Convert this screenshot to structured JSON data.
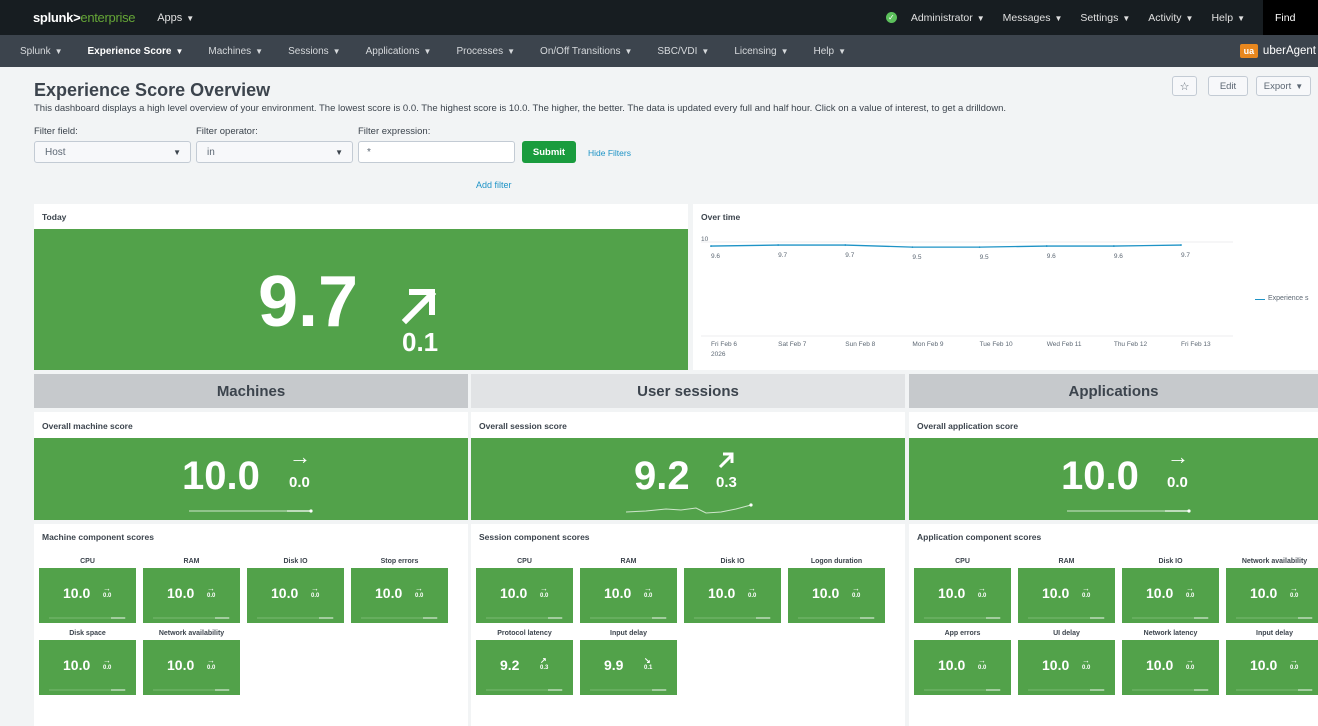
{
  "topbar": {
    "brand_main": "splunk>",
    "brand_sub": "enterprise",
    "apps": "Apps",
    "right_items": [
      "Administrator",
      "Messages",
      "Settings",
      "Activity",
      "Help"
    ],
    "find": "Find"
  },
  "nav": {
    "items": [
      "Splunk",
      "Experience Score",
      "Machines",
      "Sessions",
      "Applications",
      "Processes",
      "On/Off Transitions",
      "SBC/VDI",
      "Licensing",
      "Help"
    ],
    "active_index": 1,
    "brand": "uberAgent",
    "brand_icon": "ua"
  },
  "header": {
    "title": "Experience Score Overview",
    "description": "This dashboard displays a high level overview of your environment. The lowest score is 0.0. The highest score is 10.0. The higher, the better. The data is updated every full and half hour. Click on a value of interest, to get a drilldown.",
    "star": "☆",
    "edit": "Edit",
    "export": "Export"
  },
  "filters": {
    "field_label": "Filter field:",
    "field_value": "Host",
    "operator_label": "Filter operator:",
    "operator_value": "in",
    "expression_label": "Filter expression:",
    "expression_value": "*",
    "submit": "Submit",
    "hide": "Hide Filters",
    "add": "Add filter"
  },
  "today": {
    "title": "Today",
    "value": "9.7",
    "trend": "up",
    "delta": "0.1"
  },
  "over_time": {
    "title": "Over time",
    "legend": "Experience s",
    "y_tick": "10",
    "date_year": "2026"
  },
  "chart_data": {
    "type": "line",
    "x": [
      "Fri Feb 6",
      "Sat Feb 7",
      "Sun Feb 8",
      "Mon Feb 9",
      "Tue Feb 10",
      "Wed Feb 11",
      "Thu Feb 12",
      "Fri Feb 13"
    ],
    "series": [
      {
        "name": "Experience s",
        "values": [
          9.6,
          9.7,
          9.7,
          9.5,
          9.5,
          9.6,
          9.6,
          9.7
        ]
      }
    ],
    "y_ticks": [
      "10"
    ],
    "ylim": [
      0,
      10
    ],
    "legend_position": "right",
    "color": "#1e93c6"
  },
  "sections": [
    "Machines",
    "User sessions",
    "Applications"
  ],
  "overall": [
    {
      "title": "Overall machine score",
      "value": "10.0",
      "trend": "right",
      "delta": "0.0"
    },
    {
      "title": "Overall session score",
      "value": "9.2",
      "trend": "up",
      "delta": "0.3"
    },
    {
      "title": "Overall application score",
      "value": "10.0",
      "trend": "right",
      "delta": "0.0"
    }
  ],
  "components": [
    {
      "title": "Machine component scores",
      "tiles": [
        {
          "label": "CPU",
          "value": "10.0",
          "trend": "right",
          "delta": "0.0"
        },
        {
          "label": "RAM",
          "value": "10.0",
          "trend": "right",
          "delta": "0.0"
        },
        {
          "label": "Disk IO",
          "value": "10.0",
          "trend": "right",
          "delta": "0.0"
        },
        {
          "label": "Stop errors",
          "value": "10.0",
          "trend": "right",
          "delta": "0.0"
        },
        {
          "label": "Disk space",
          "value": "10.0",
          "trend": "right",
          "delta": "0.0"
        },
        {
          "label": "Network availability",
          "value": "10.0",
          "trend": "right",
          "delta": "0.0"
        }
      ]
    },
    {
      "title": "Session component scores",
      "tiles": [
        {
          "label": "CPU",
          "value": "10.0",
          "trend": "right",
          "delta": "0.0"
        },
        {
          "label": "RAM",
          "value": "10.0",
          "trend": "right",
          "delta": "0.0"
        },
        {
          "label": "Disk IO",
          "value": "10.0",
          "trend": "right",
          "delta": "0.0"
        },
        {
          "label": "Logon duration",
          "value": "10.0",
          "trend": "right",
          "delta": "0.0"
        },
        {
          "label": "Protocol latency",
          "value": "9.2",
          "trend": "up",
          "delta": "0.3"
        },
        {
          "label": "Input delay",
          "value": "9.9",
          "trend": "down",
          "delta": "0.1"
        }
      ]
    },
    {
      "title": "Application component scores",
      "tiles": [
        {
          "label": "CPU",
          "value": "10.0",
          "trend": "right",
          "delta": "0.0"
        },
        {
          "label": "RAM",
          "value": "10.0",
          "trend": "right",
          "delta": "0.0"
        },
        {
          "label": "Disk IO",
          "value": "10.0",
          "trend": "right",
          "delta": "0.0"
        },
        {
          "label": "Network availability",
          "value": "10.0",
          "trend": "right",
          "delta": "0.0"
        },
        {
          "label": "App errors",
          "value": "10.0",
          "trend": "right",
          "delta": "0.0"
        },
        {
          "label": "UI delay",
          "value": "10.0",
          "trend": "right",
          "delta": "0.0"
        },
        {
          "label": "Network latency",
          "value": "10.0",
          "trend": "right",
          "delta": "0.0"
        },
        {
          "label": "Input delay",
          "value": "10.0",
          "trend": "right",
          "delta": "0.0"
        }
      ]
    }
  ]
}
